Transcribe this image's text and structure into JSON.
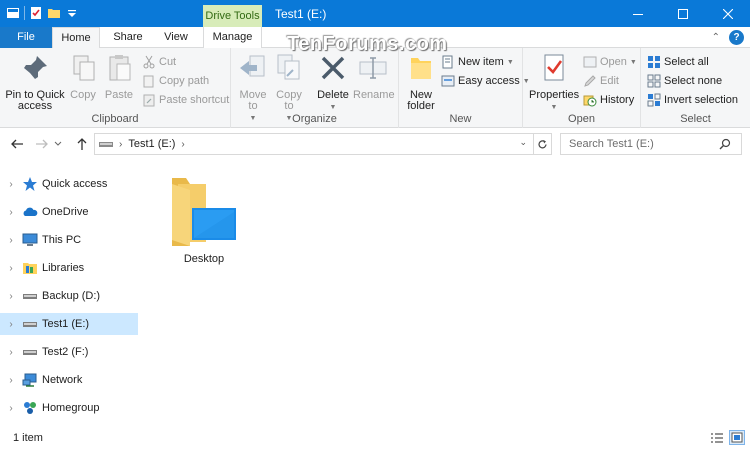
{
  "titlebar": {
    "context_tab": "Drive Tools",
    "title": "Test1 (E:)",
    "icons": [
      "explorer-icon",
      "properties-icon",
      "new-folder-icon",
      "qat-dropdown-icon"
    ],
    "controls": [
      "minimize-icon",
      "maximize-icon",
      "close-icon"
    ]
  },
  "tabs": {
    "file": "File",
    "home": "Home",
    "share": "Share",
    "view": "View",
    "manage": "Manage"
  },
  "ribbon": {
    "clipboard": {
      "label": "Clipboard",
      "pin": "Pin to Quick access",
      "copy": "Copy",
      "paste": "Paste",
      "cut": "Cut",
      "copy_path": "Copy path",
      "paste_shortcut": "Paste shortcut"
    },
    "organize": {
      "label": "Organize",
      "move_to": "Move to",
      "copy_to": "Copy to",
      "delete": "Delete",
      "rename": "Rename"
    },
    "new": {
      "label": "New",
      "new_folder": "New folder",
      "new_item": "New item",
      "easy_access": "Easy access"
    },
    "open": {
      "label": "Open",
      "properties": "Properties",
      "open": "Open",
      "edit": "Edit",
      "history": "History"
    },
    "select": {
      "label": "Select",
      "select_all": "Select all",
      "select_none": "Select none",
      "invert": "Invert selection"
    }
  },
  "address": {
    "path": [
      "Test1 (E:)"
    ],
    "search_placeholder": "Search Test1 (E:)"
  },
  "nav": {
    "items": [
      {
        "label": "Quick access",
        "icon": "quick-access-star-icon",
        "selected": false
      },
      {
        "label": "OneDrive",
        "icon": "onedrive-cloud-icon",
        "selected": false
      },
      {
        "label": "This PC",
        "icon": "this-pc-monitor-icon",
        "selected": false
      },
      {
        "label": "Libraries",
        "icon": "libraries-icon",
        "selected": false
      },
      {
        "label": "Backup (D:)",
        "icon": "drive-icon",
        "selected": false
      },
      {
        "label": "Test1 (E:)",
        "icon": "drive-icon",
        "selected": true
      },
      {
        "label": "Test2 (F:)",
        "icon": "drive-icon",
        "selected": false
      },
      {
        "label": "Network",
        "icon": "network-icon",
        "selected": false
      },
      {
        "label": "Homegroup",
        "icon": "homegroup-icon",
        "selected": false
      }
    ]
  },
  "content": {
    "items": [
      {
        "name": "Desktop",
        "icon": "desktop-folder-icon"
      }
    ]
  },
  "status": {
    "count": "1 item"
  },
  "watermark": "TenForums.com",
  "colors": {
    "accent": "#0a79d8",
    "selection": "#cce8ff",
    "drive_tools": "#d8ecb9"
  }
}
